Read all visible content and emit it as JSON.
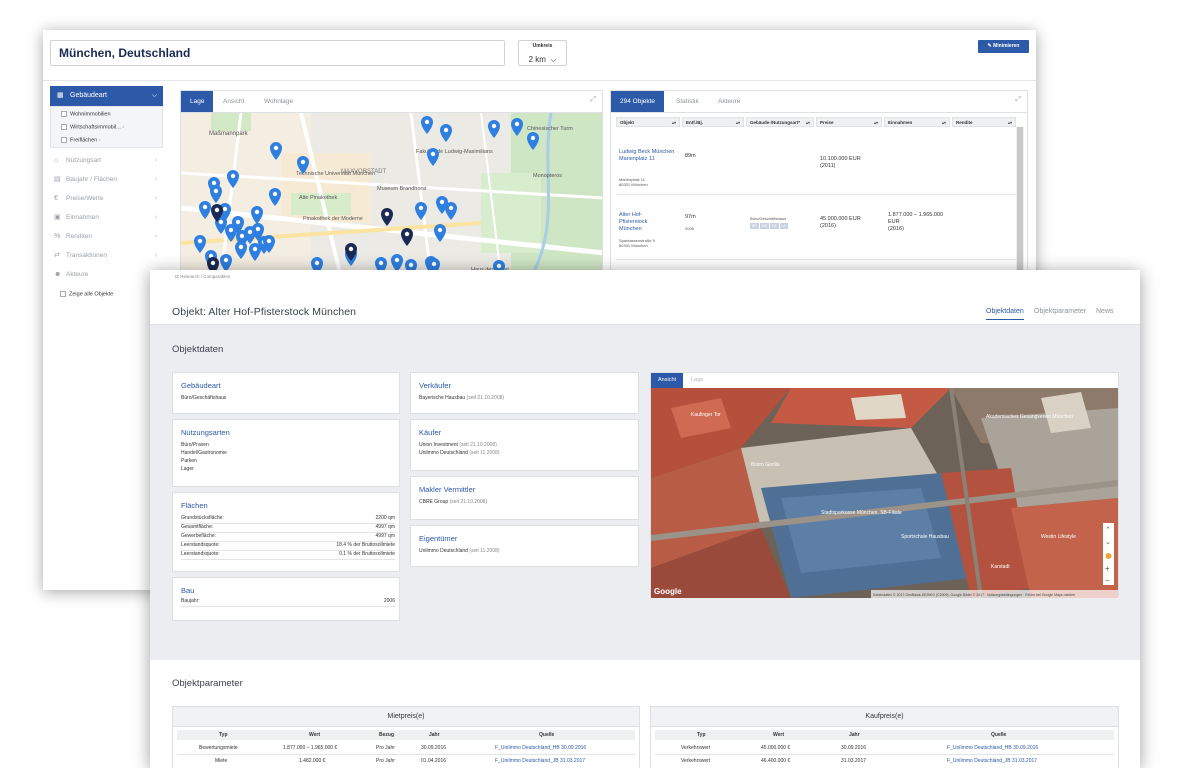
{
  "back": {
    "location": "München, Deutschland",
    "radius_label": "Umkreis",
    "radius_value": "2 km",
    "minimize_label": "Minimieren",
    "sidebar": {
      "active": "Gebäudeart",
      "subitems": [
        "Wohnimmobilien",
        "Wirtschaftsimmobil...",
        "Freiflächen"
      ],
      "items": [
        "Nutzungsart",
        "Baujahr / Flächen",
        "Preise/Werte",
        "Einnahmen",
        "Renditen",
        "Transaktionen",
        "Akteure"
      ],
      "show_all": "Zeige alle Objekte"
    },
    "map_tabs": [
      "Lage",
      "Ansicht",
      "Wohnlage"
    ],
    "map_labels": [
      "Maßmannpark",
      "Technische Universität München",
      "MAXVORSTADT",
      "Museum Brandhorst",
      "Alte Pinakothek",
      "Pinakothek der Moderne",
      "Fakultät de Ludwig-Maximilians",
      "Chinesischer Turm",
      "Monopteros",
      "Haus der Kunst"
    ],
    "obj_tabs": [
      "294 Objekte",
      "Statistik",
      "Akteure"
    ],
    "table_headers": [
      "Objekt",
      "Entf./Bj.",
      "Gebäude-/Nutzungsart*",
      "Preise",
      "Einnahmen",
      "Rendite"
    ],
    "rows": [
      {
        "name": "Ludwig Beck München Marienplatz 11",
        "addr1": "Marienplatz 11",
        "addr2": "80331 München",
        "dist": "89m",
        "year": "",
        "type": "",
        "price": "10.100.000 EUR",
        "price_year": "(2011)",
        "income": "",
        "income_year": ""
      },
      {
        "name": "Alter Hof-Pfisterstock München",
        "addr1": "Sparkassenstraße 9",
        "addr2": "80331 München",
        "dist": "97m",
        "year": "2006",
        "type": "Büro/Geschäftshaus",
        "tags": [
          "BR",
          "HG",
          "PA",
          "LA"
        ],
        "price": "45.000.000 EUR",
        "price_year": "(2016)",
        "income": "1.877.000 – 1.965.000 EUR",
        "income_year": "(2016)"
      }
    ]
  },
  "front": {
    "breadcrumb": "IZ Research / Comparables",
    "title": "Objekt: Alter Hof-Pfisterstock München",
    "nav": [
      "Objektdaten",
      "Objektparameter",
      "News"
    ],
    "section_objektdaten": "Objektdaten",
    "gebaeudeart": {
      "title": "Gebäudeart",
      "value": "Büro/Geschäftshaus"
    },
    "nutzungsarten": {
      "title": "Nutzungsarten",
      "values": [
        "Büro/Praxen",
        "Handel/Gastronomie",
        "Parken",
        "Lager"
      ]
    },
    "flaechen": {
      "title": "Flächen",
      "rows": [
        {
          "k": "Grundstücksfläche:",
          "v": "2200 qm"
        },
        {
          "k": "Gesamtfläche:",
          "v": "4997 qm"
        },
        {
          "k": "Gewerbefläche:",
          "v": "4997 qm"
        },
        {
          "k": "Leerstandsquote:",
          "v": "18.4 % der Bruttosollmiete"
        },
        {
          "k": "Leerstandsquote:",
          "v": "0.1 % der Bruttosollmiete"
        }
      ]
    },
    "bau": {
      "title": "Bau",
      "k": "Baujahr:",
      "v": "2006"
    },
    "verkaeufer": {
      "title": "Verkäufer",
      "name": "Bayerische Hausbau",
      "date": "(seit 21.10.2008)"
    },
    "kaeufer": {
      "title": "Käufer",
      "rows": [
        {
          "name": "Union Investment",
          "date": "(seit 21.10.2008)"
        },
        {
          "name": "Unilmmo Deutschland",
          "date": "(seit 11.2008)"
        }
      ]
    },
    "makler": {
      "title": "Makler Vermittler",
      "name": "CBRE Group",
      "date": "(seit 21.10.2008)"
    },
    "eigentuemer": {
      "title": "Eigentümer",
      "name": "Unilmmo Deutschland",
      "date": "(seit 11.2008)"
    },
    "aerial_tabs": [
      "Ansicht",
      "Lage"
    ],
    "aerial_labels": [
      "Stadtsparkasse München, SB-Filiale",
      "Bistro Gorilla",
      "Sportschule Hausbau",
      "Westin Lifestyle",
      "Kaufinger Tor",
      "Akademisches Gesangverein München",
      "Karstadt"
    ],
    "google": "Google",
    "map_attrib": "Kartendaten © 2017 GeoBasis-DE/BKG (©2009), Google Bilder © 2017 · Nutzungsbedingungen · Fehler bei Google Maps melden",
    "section_objektparameter": "Objektparameter",
    "miet": {
      "title": "Mietpreis(e)",
      "headers": [
        "Typ",
        "Wert",
        "Bezug",
        "Jahr",
        "Quelle"
      ],
      "rows": [
        [
          "Bewertungsmiete",
          "1.877.000 – 1.965.000 €",
          "Pro Jahr",
          "30.09.2016",
          "F_UniImmo Deutschland_HB 30.09.2016"
        ],
        [
          "Miete",
          "1.482.000 €",
          "Pro Jahr",
          "01.04.2016",
          "F_UniImmo Deutschland_JB 31.03.2017"
        ]
      ]
    },
    "kauf": {
      "title": "Kaufpreis(e)",
      "headers": [
        "Typ",
        "Wert",
        "Jahr",
        "Quelle"
      ],
      "rows": [
        [
          "Verkehrswert",
          "45.000.000 €",
          "30.09.2016",
          "F_UniImmo Deutschland_HB 30.09.2016"
        ],
        [
          "Verkehrswert",
          "46.400.000 €",
          "31.03.2017",
          "F_UniImmo Deutschland_JB 31.03.2017"
        ]
      ]
    }
  }
}
